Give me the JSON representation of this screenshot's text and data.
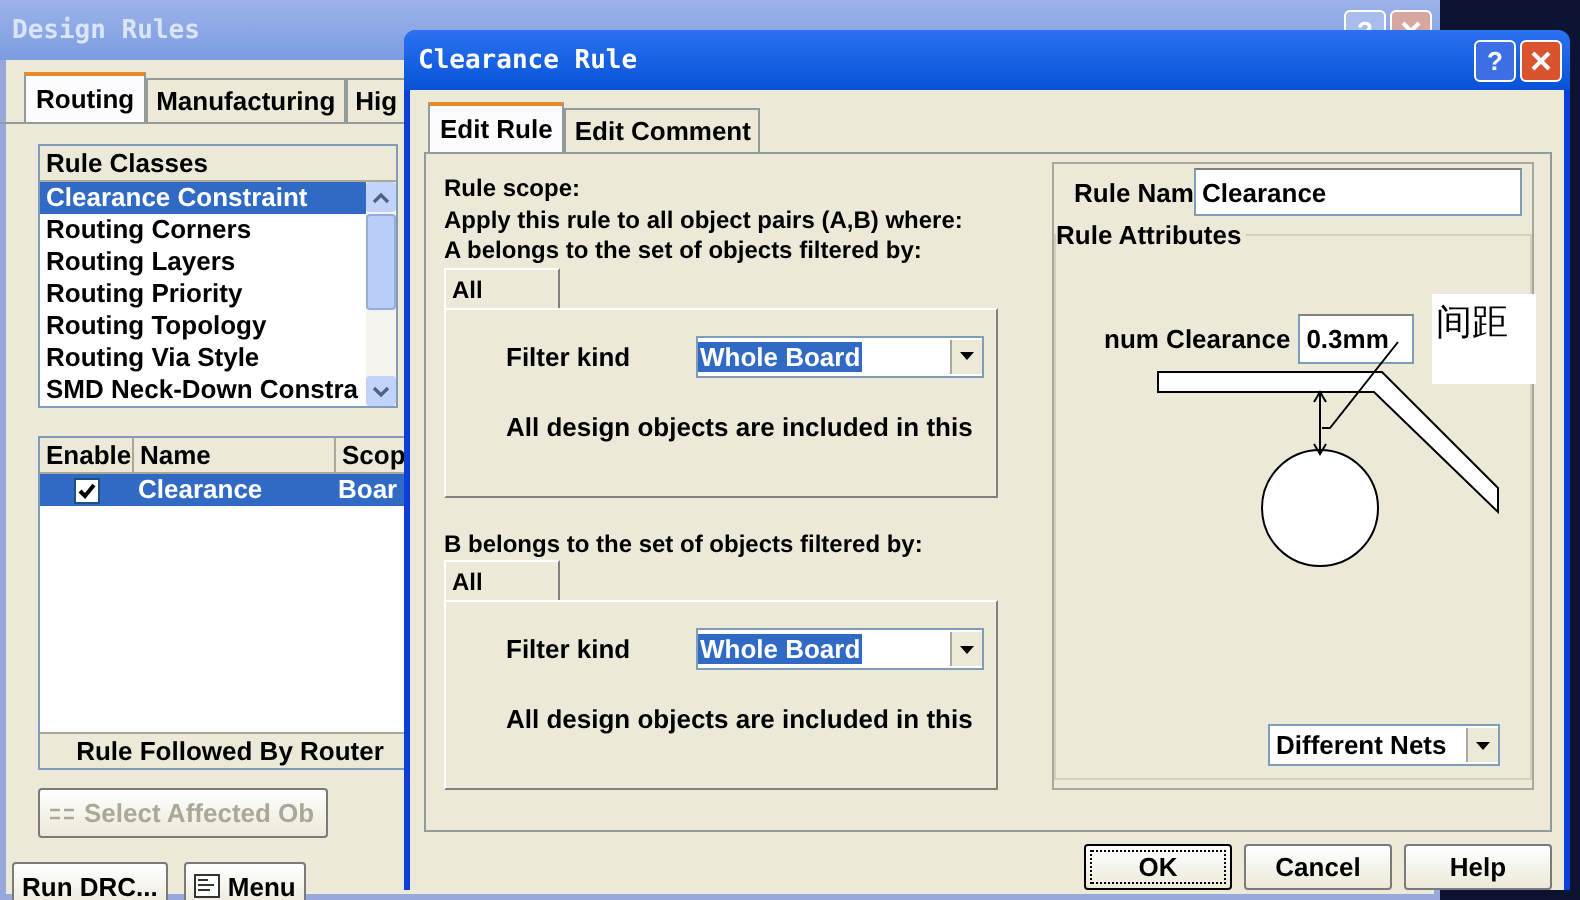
{
  "back_window": {
    "title": "Design Rules",
    "help_glyph": "?",
    "tabs": [
      {
        "label": "Routing",
        "selected": true
      },
      {
        "label": "Manufacturing",
        "selected": false
      },
      {
        "label": "Hig",
        "selected": false
      }
    ],
    "rule_classes": {
      "title": "Rule Classes",
      "items": [
        {
          "label": "Clearance Constraint",
          "selected": true
        },
        {
          "label": "Routing Corners",
          "selected": false
        },
        {
          "label": "Routing Layers",
          "selected": false
        },
        {
          "label": "Routing Priority",
          "selected": false
        },
        {
          "label": "Routing Topology",
          "selected": false
        },
        {
          "label": "Routing Via Style",
          "selected": false
        },
        {
          "label": "SMD Neck-Down Constra",
          "selected": false
        }
      ]
    },
    "rules_table": {
      "columns": [
        "Enable",
        "Name",
        "Scop"
      ],
      "rows": [
        {
          "enabled": true,
          "name": "Clearance",
          "scope": "Boar",
          "selected": true
        }
      ],
      "footer": "Rule Followed By Router"
    },
    "select_button": {
      "label": "Select Affected Ob",
      "disabled": true
    },
    "buttons": [
      {
        "label": "Run DRC...",
        "kind": "plain"
      },
      {
        "label": "Menu",
        "kind": "menu"
      }
    ]
  },
  "dialog": {
    "title": "Clearance Rule",
    "help_glyph": "?",
    "tabs": [
      {
        "label": "Edit Rule",
        "selected": true
      },
      {
        "label": "Edit Comment",
        "selected": false
      }
    ],
    "scope_heading": "Rule scope:",
    "scope_text": "Apply this rule to all object pairs (A,B) where:",
    "filters": [
      {
        "heading": "A belongs to the set of objects filtered by:",
        "tab": "All",
        "filter_label": "Filter kind",
        "filter_value": "Whole Board",
        "description": "All design objects are included in this"
      },
      {
        "heading": "B belongs to the set of objects filtered by:",
        "tab": "All",
        "filter_label": "Filter kind",
        "filter_value": "Whole Board",
        "description": "All design objects are included in this"
      }
    ],
    "rule_name": {
      "label": "Rule Nam",
      "value": "Clearance"
    },
    "attributes": {
      "title": "Rule Attributes",
      "clearance_label": "num Clearance",
      "clearance_value": "0.3mm",
      "annotation": "间距",
      "net_scope": "Different Nets"
    },
    "buttons": [
      {
        "label": "OK",
        "focused": true
      },
      {
        "label": "Cancel",
        "focused": false
      },
      {
        "label": "Help",
        "focused": false
      }
    ]
  }
}
